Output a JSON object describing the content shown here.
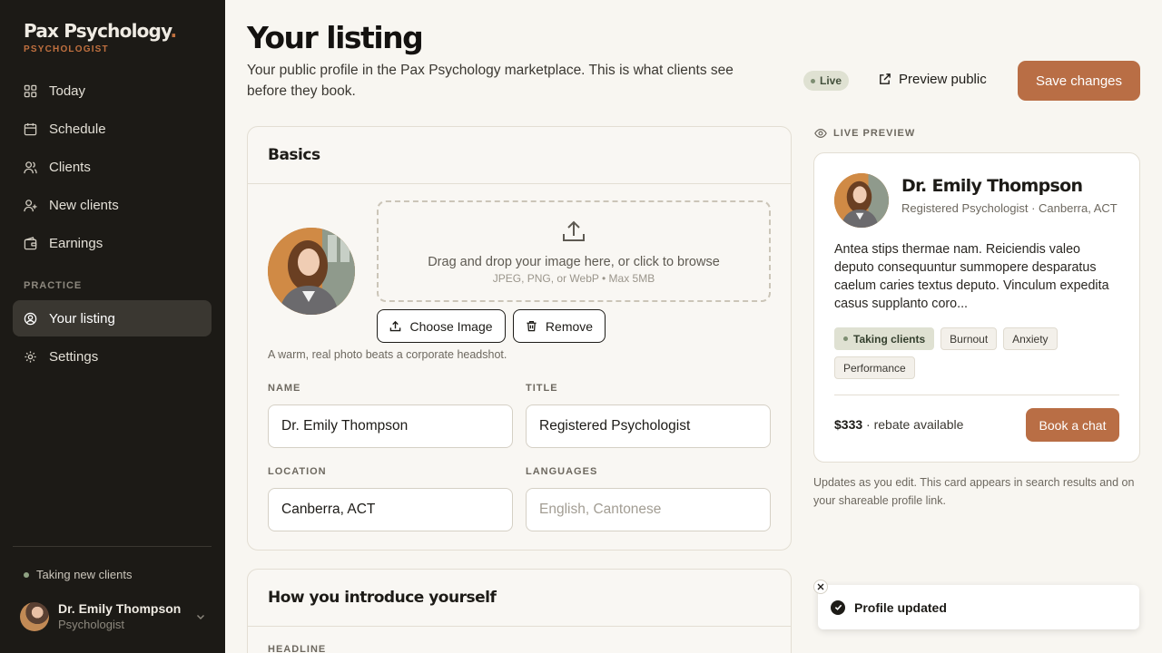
{
  "brand": {
    "name": "Pax Psychology",
    "dot": ".",
    "role": "PSYCHOLOGIST"
  },
  "sidebar": {
    "items": [
      {
        "label": "Today",
        "icon": "grid-icon"
      },
      {
        "label": "Schedule",
        "icon": "calendar-icon"
      },
      {
        "label": "Clients",
        "icon": "users-icon"
      },
      {
        "label": "New clients",
        "icon": "user-plus-icon"
      },
      {
        "label": "Earnings",
        "icon": "wallet-icon"
      }
    ],
    "section_label": "PRACTICE",
    "practice_items": [
      {
        "label": "Your listing",
        "icon": "user-circle-icon",
        "active": true
      },
      {
        "label": "Settings",
        "icon": "gear-icon"
      }
    ],
    "status": "Taking new clients",
    "user": {
      "name": "Dr. Emily Thompson",
      "role": "Psychologist"
    }
  },
  "header": {
    "title": "Your listing",
    "subtitle": "Your public profile in the Pax Psychology marketplace. This is what clients see before they book.",
    "live_badge": "Live",
    "preview_label": "Preview public",
    "save_label": "Save changes"
  },
  "basics": {
    "title": "Basics",
    "drop_main": "Drag and drop your image here, or click to browse",
    "drop_sub": "JPEG, PNG, or WebP • Max 5MB",
    "choose_label": "Choose Image",
    "remove_label": "Remove",
    "hint": "A warm, real photo beats a corporate headshot.",
    "name_label": "NAME",
    "name_value": "Dr. Emily Thompson",
    "title_label": "TITLE",
    "title_value": "Registered Psychologist",
    "location_label": "LOCATION",
    "location_value": "Canberra, ACT",
    "languages_label": "LANGUAGES",
    "languages_placeholder": "English, Cantonese"
  },
  "intro": {
    "title": "How you introduce yourself",
    "headline_label": "HEADLINE"
  },
  "preview": {
    "label": "LIVE PREVIEW",
    "name": "Dr. Emily Thompson",
    "meta": "Registered Psychologist · Canberra, ACT",
    "bio": "Antea stips thermae nam. Reiciendis valeo deputo consequuntur summopere desparatus caelum caries textus deputo. Vinculum expedita casus supplanto coro...",
    "tags": [
      "Taking clients",
      "Burnout",
      "Anxiety",
      "Performance"
    ],
    "price": "$333",
    "price_note": " · rebate available",
    "book_label": "Book a chat",
    "note": "Updates as you edit. This card appears in search results and on your shareable profile link."
  },
  "toast": {
    "message": "Profile updated"
  },
  "colors": {
    "accent": "#b96e45",
    "sidebar": "#1c1a16",
    "live_green": "#dfe1d2"
  }
}
